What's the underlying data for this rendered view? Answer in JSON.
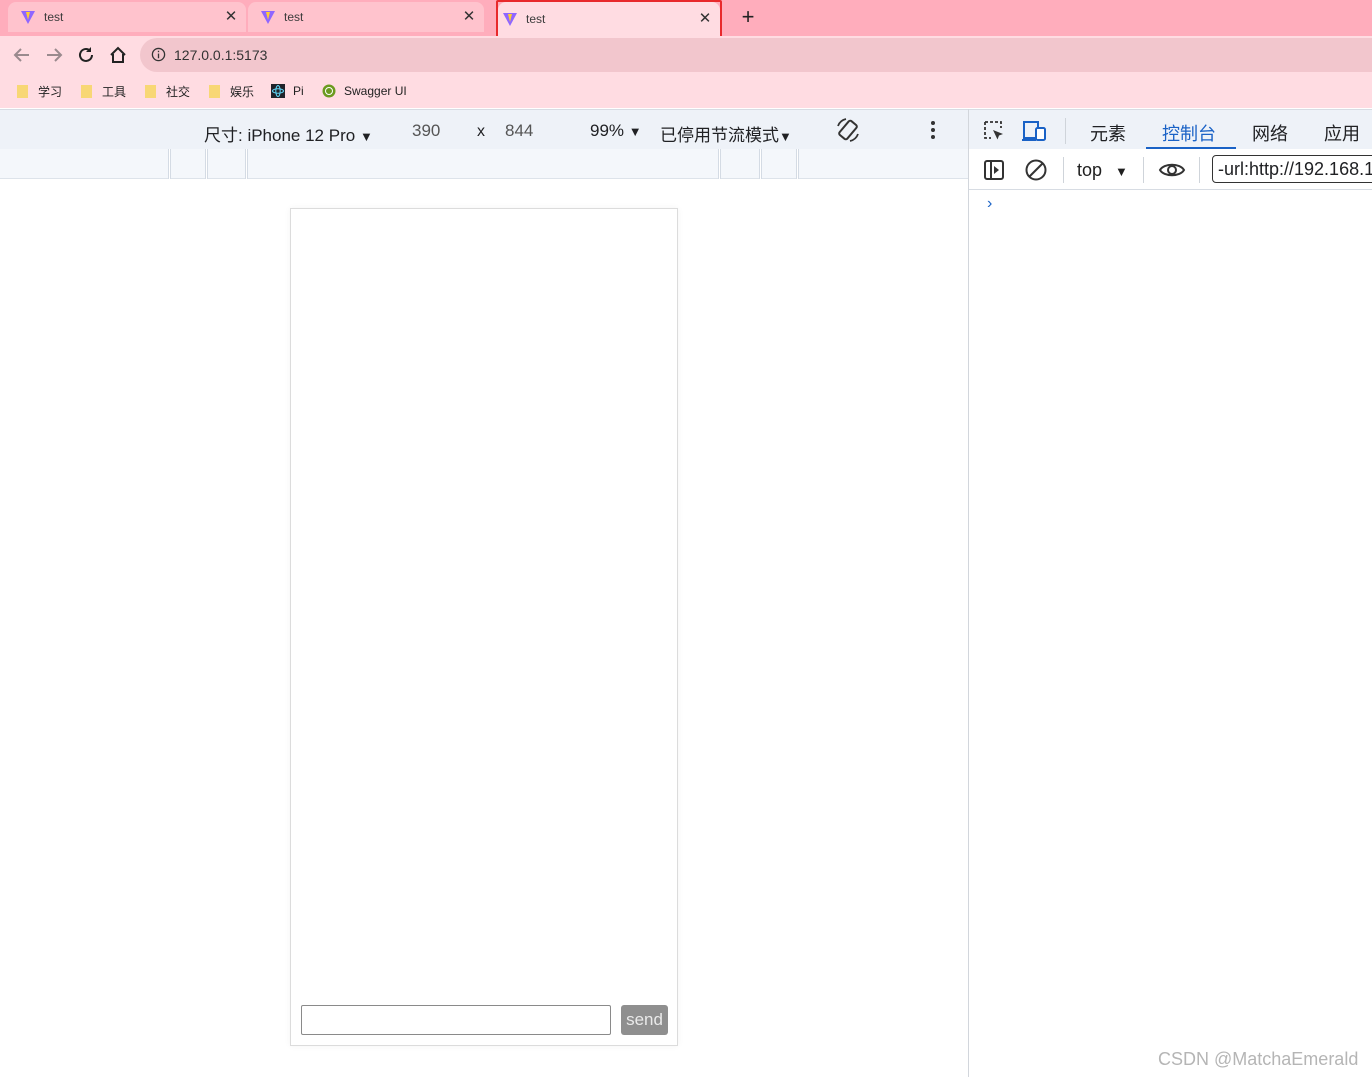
{
  "browser": {
    "tabs": [
      {
        "title": "test",
        "active": false
      },
      {
        "title": "test",
        "active": false
      },
      {
        "title": "test",
        "active": true
      }
    ],
    "address": "127.0.0.1:5173",
    "bookmarks": [
      {
        "label": "学习",
        "icon": "folder-icon"
      },
      {
        "label": "工具",
        "icon": "folder-icon"
      },
      {
        "label": "社交",
        "icon": "folder-icon"
      },
      {
        "label": "娱乐",
        "icon": "folder-icon"
      },
      {
        "label": "Pi",
        "icon": "react-icon"
      },
      {
        "label": "Swagger UI",
        "icon": "swagger-icon"
      }
    ],
    "colors": {
      "tab_strip": "#ffadbc",
      "toolbar": "#ffdce2",
      "highlight": "#e8292c"
    }
  },
  "device_toolbar": {
    "dimensions_label": "尺寸: iPhone 12 Pro",
    "width": "390",
    "times": "x",
    "height": "844",
    "zoom": "99%",
    "throttle": "已停用节流模式"
  },
  "page": {
    "input_value": "",
    "send_label": "send"
  },
  "devtools": {
    "tabs": [
      "元素",
      "控制台",
      "网络",
      "应用"
    ],
    "active_tab": "控制台",
    "context": "top",
    "filter_value": "-url:http://192.168.1",
    "prompt": "›"
  },
  "watermark": "CSDN @MatchaEmerald"
}
